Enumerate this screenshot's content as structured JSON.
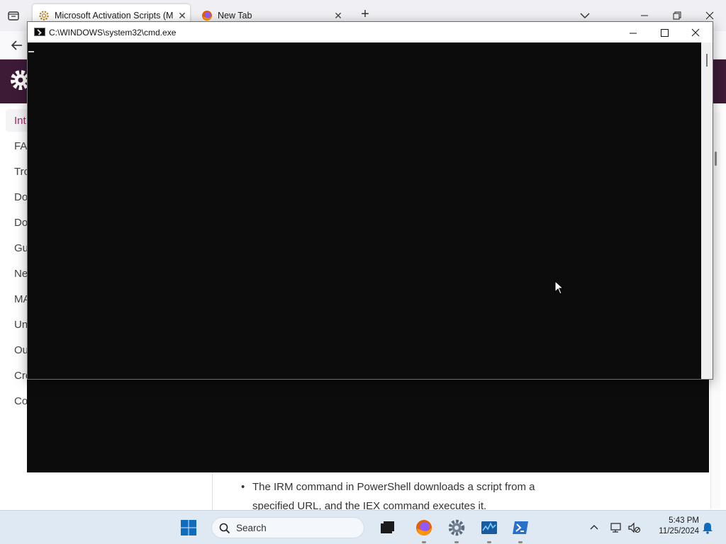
{
  "browser": {
    "tabs": [
      {
        "title": "Microsoft Activation Scripts (M",
        "favicon": "gear-favicon"
      },
      {
        "title": "New Tab",
        "favicon": "firefox-favicon"
      }
    ],
    "new_tab_symbol": "+",
    "close_symbol": "✕"
  },
  "sidebar": {
    "items": [
      {
        "label": "Int",
        "active": true
      },
      {
        "label": "FA"
      },
      {
        "label": "Tro"
      },
      {
        "label": "Do"
      },
      {
        "label": "Do"
      },
      {
        "label": "Gu"
      },
      {
        "label": "Ne"
      },
      {
        "label": "MA"
      },
      {
        "label": "Un"
      },
      {
        "label": "Ou"
      },
      {
        "label": "Cre"
      },
      {
        "label": "Co"
      }
    ]
  },
  "content": {
    "bullet_text": "The IRM command in PowerShell downloads a script from a specified URL, and the IEX command executes it."
  },
  "cmd": {
    "title": "C:\\WINDOWS\\system32\\cmd.exe",
    "minimize": "—",
    "maximize": "☐",
    "close": "✕",
    "background": "#0c0c0c"
  },
  "taskbar": {
    "search_placeholder": "Search",
    "time": "5:43 PM",
    "date": "11/25/2024",
    "tray_chevron": "^"
  },
  "colors": {
    "site_header": "#3d1a36",
    "active_nav": "#9a2b6a",
    "taskbar": "#dfe9f3"
  }
}
